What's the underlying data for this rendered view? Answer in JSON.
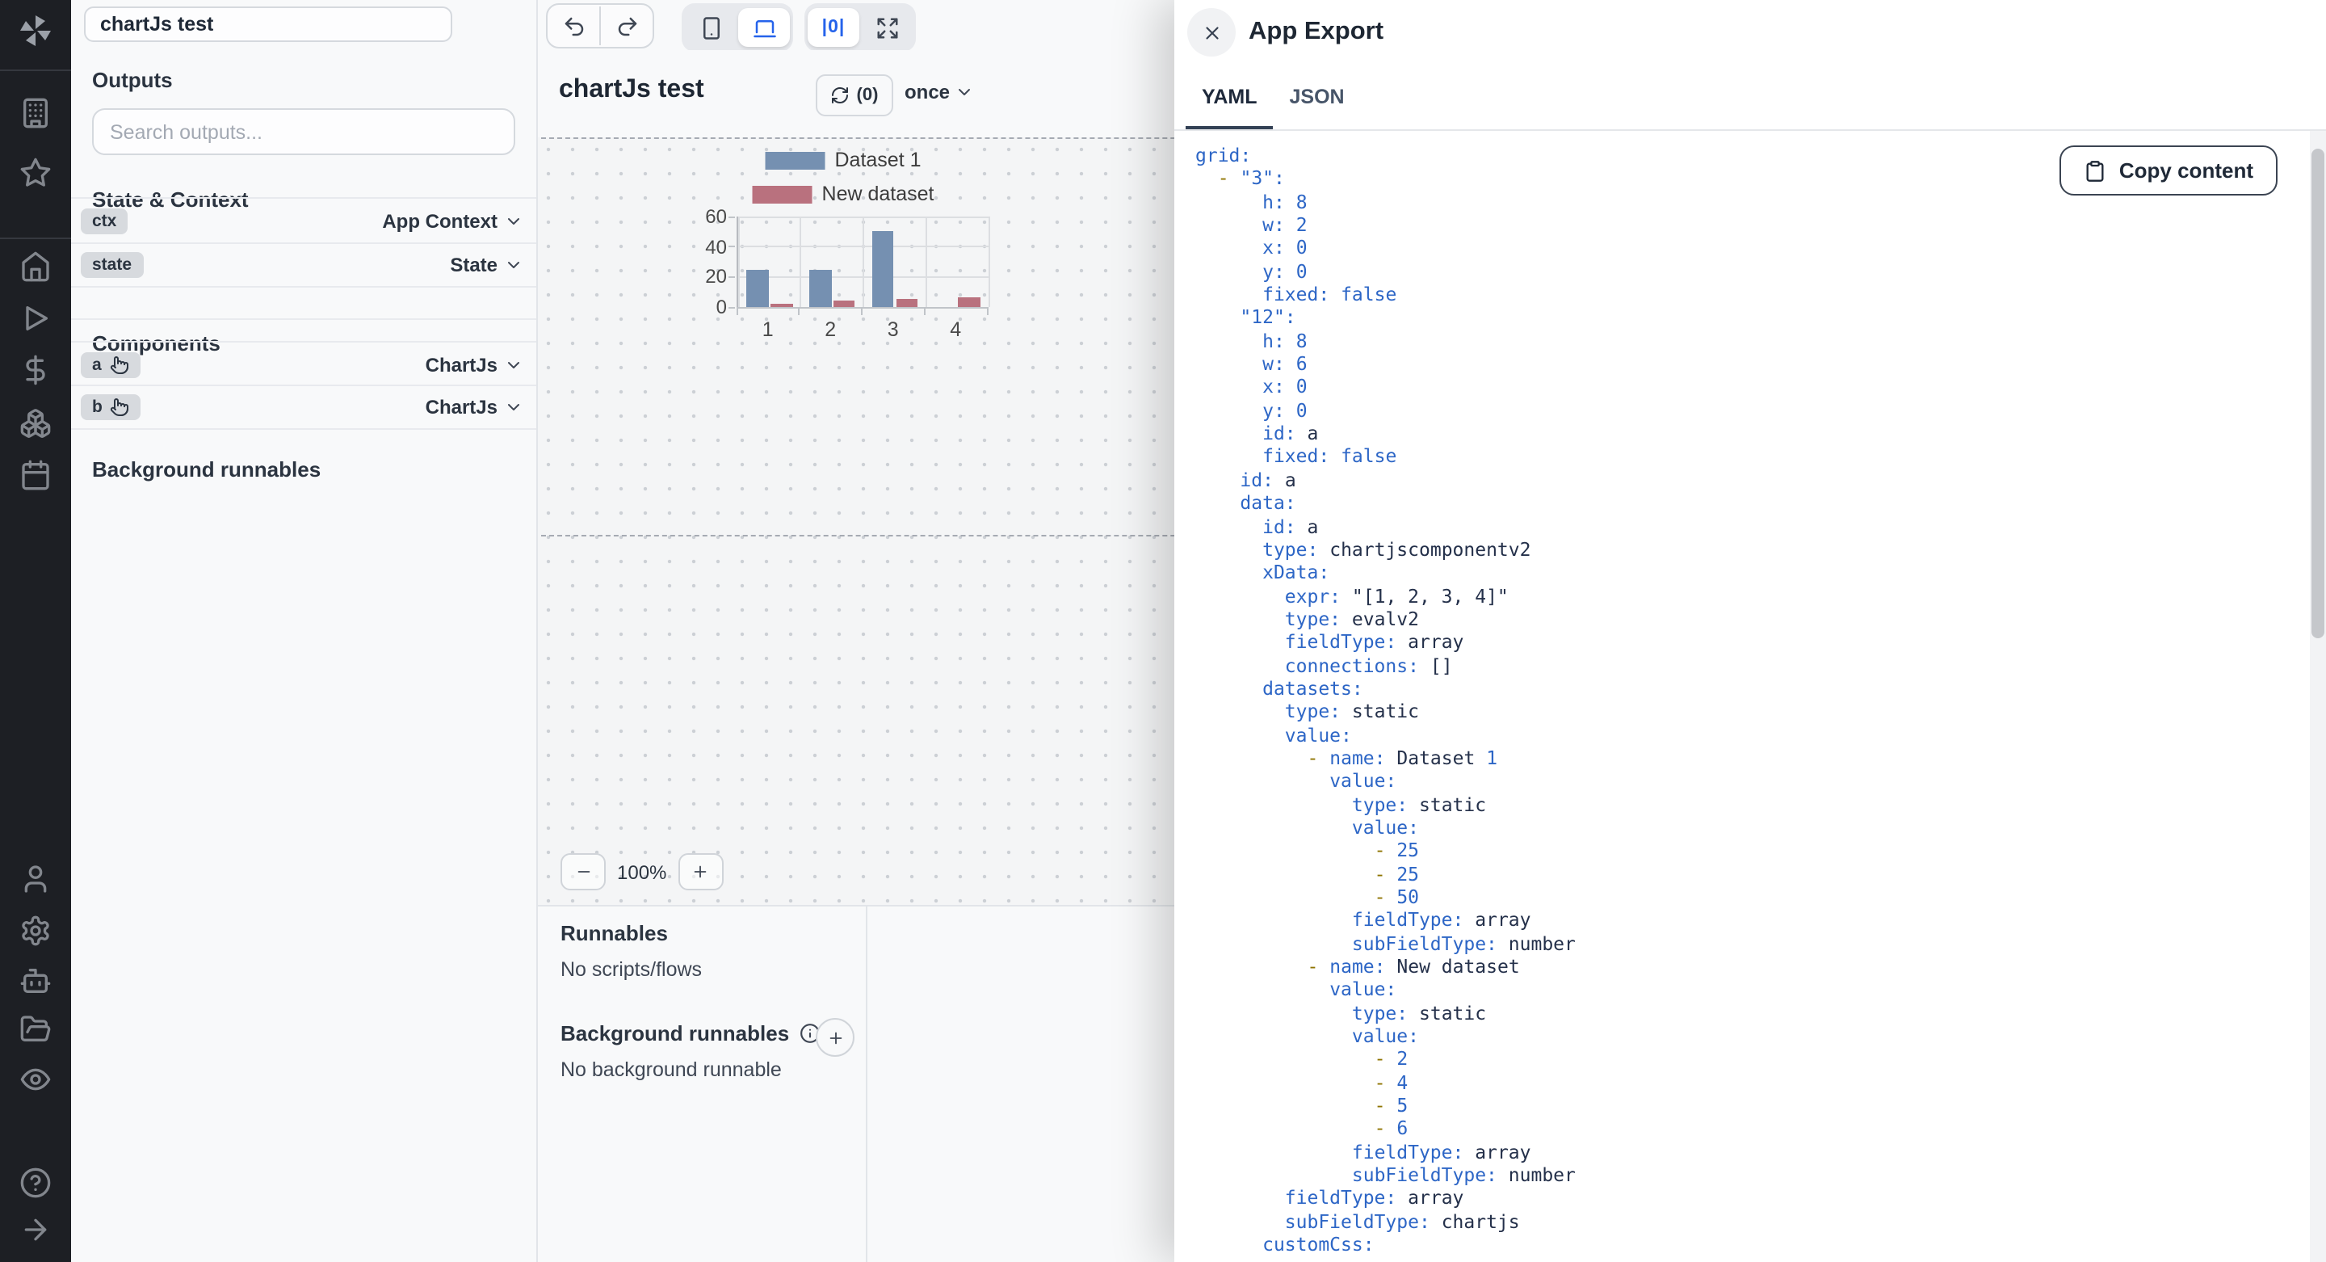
{
  "topbar": {
    "app_name_value": "chartJs test",
    "history_buttons": [
      {
        "icon": "undo"
      },
      {
        "icon": "redo"
      }
    ],
    "device_toggle": [
      {
        "icon": "smartphone",
        "active": false
      },
      {
        "icon": "laptop",
        "active": true
      }
    ],
    "view_toggle": {
      "zero_label": "|0|",
      "expand_icon": "expand"
    }
  },
  "sidebar": {
    "groups": [
      {
        "items": [
          "building",
          "star"
        ]
      },
      {
        "items": [
          "home",
          "play",
          "dollar-sign",
          "boxes",
          "calendar"
        ]
      },
      {
        "items": [
          "user",
          "settings",
          "bot",
          "folder-open",
          "eye"
        ]
      },
      {
        "items": [
          "help-circle",
          "arrow-right"
        ]
      }
    ]
  },
  "left_panel": {
    "outputs_title": "Outputs",
    "search_placeholder": "Search outputs...",
    "state_context_title": "State & Context",
    "state_rows": [
      {
        "id": "ctx",
        "type": "App Context"
      },
      {
        "id": "state",
        "type": "State"
      }
    ],
    "components_title": "Components",
    "component_rows": [
      {
        "id": "a",
        "type": "ChartJs"
      },
      {
        "id": "b",
        "type": "ChartJs"
      }
    ],
    "background_title": "Background runnables"
  },
  "editor": {
    "title": "chartJs test",
    "refresh_count": "(0)",
    "refresh_mode": "once",
    "zoom_level": "100%",
    "runnables_title": "Runnables",
    "runnables_empty": "No scripts/flows",
    "background_title": "Background runnables",
    "background_empty": "No background runnable"
  },
  "chart_data": {
    "type": "bar",
    "categories": [
      "1",
      "2",
      "3",
      "4"
    ],
    "series": [
      {
        "name": "Dataset 1",
        "color": "#7590b1",
        "values": [
          25,
          25,
          50
        ]
      },
      {
        "name": "New dataset",
        "color": "#b9717e",
        "values": [
          2,
          4,
          5,
          6
        ]
      }
    ],
    "title": "",
    "xlabel": "",
    "ylabel": "",
    "ylim": [
      0,
      60
    ],
    "yticks": [
      0,
      20,
      40,
      60
    ],
    "grid": true,
    "legend_position": "top"
  },
  "export_panel": {
    "title": "App Export",
    "tabs": [
      {
        "label": "YAML",
        "active": true
      },
      {
        "label": "JSON",
        "active": false
      }
    ],
    "copy_button": "Copy content",
    "yaml_lines": [
      {
        "i": 0,
        "t": [
          [
            "k",
            "grid:"
          ]
        ]
      },
      {
        "i": 2,
        "t": [
          [
            "d",
            "-"
          ],
          [
            "k",
            "\"3\":"
          ]
        ]
      },
      {
        "i": 6,
        "t": [
          [
            "k",
            "h:"
          ],
          [
            "n",
            "8"
          ]
        ]
      },
      {
        "i": 6,
        "t": [
          [
            "k",
            "w:"
          ],
          [
            "n",
            "2"
          ]
        ]
      },
      {
        "i": 6,
        "t": [
          [
            "k",
            "x:"
          ],
          [
            "n",
            "0"
          ]
        ]
      },
      {
        "i": 6,
        "t": [
          [
            "k",
            "y:"
          ],
          [
            "n",
            "0"
          ]
        ]
      },
      {
        "i": 6,
        "t": [
          [
            "k",
            "fixed:"
          ],
          [
            "n",
            "false"
          ]
        ]
      },
      {
        "i": 4,
        "t": [
          [
            "k",
            "\"12\":"
          ]
        ]
      },
      {
        "i": 6,
        "t": [
          [
            "k",
            "h:"
          ],
          [
            "n",
            "8"
          ]
        ]
      },
      {
        "i": 6,
        "t": [
          [
            "k",
            "w:"
          ],
          [
            "n",
            "6"
          ]
        ]
      },
      {
        "i": 6,
        "t": [
          [
            "k",
            "x:"
          ],
          [
            "n",
            "0"
          ]
        ]
      },
      {
        "i": 6,
        "t": [
          [
            "k",
            "y:"
          ],
          [
            "n",
            "0"
          ]
        ]
      },
      {
        "i": 6,
        "t": [
          [
            "k",
            "id:"
          ],
          [
            "s",
            "a"
          ]
        ]
      },
      {
        "i": 6,
        "t": [
          [
            "k",
            "fixed:"
          ],
          [
            "n",
            "false"
          ]
        ]
      },
      {
        "i": 4,
        "t": [
          [
            "k",
            "id:"
          ],
          [
            "s",
            "a"
          ]
        ]
      },
      {
        "i": 4,
        "t": [
          [
            "k",
            "data:"
          ]
        ]
      },
      {
        "i": 6,
        "t": [
          [
            "k",
            "id:"
          ],
          [
            "s",
            "a"
          ]
        ]
      },
      {
        "i": 6,
        "t": [
          [
            "k",
            "type:"
          ],
          [
            "s",
            "chartjscomponentv2"
          ]
        ]
      },
      {
        "i": 6,
        "t": [
          [
            "k",
            "xData:"
          ]
        ]
      },
      {
        "i": 8,
        "t": [
          [
            "k",
            "expr:"
          ],
          [
            "s",
            "\"[1, 2, 3, 4]\""
          ]
        ]
      },
      {
        "i": 8,
        "t": [
          [
            "k",
            "type:"
          ],
          [
            "s",
            "evalv2"
          ]
        ]
      },
      {
        "i": 8,
        "t": [
          [
            "k",
            "fieldType:"
          ],
          [
            "s",
            "array"
          ]
        ]
      },
      {
        "i": 8,
        "t": [
          [
            "k",
            "connections:"
          ],
          [
            "s",
            "[]"
          ]
        ]
      },
      {
        "i": 6,
        "t": [
          [
            "k",
            "datasets:"
          ]
        ]
      },
      {
        "i": 8,
        "t": [
          [
            "k",
            "type:"
          ],
          [
            "s",
            "static"
          ]
        ]
      },
      {
        "i": 8,
        "t": [
          [
            "k",
            "value:"
          ]
        ]
      },
      {
        "i": 10,
        "t": [
          [
            "d",
            "-"
          ],
          [
            "k",
            "name:"
          ],
          [
            "s",
            "Dataset"
          ],
          [
            "n",
            "1"
          ]
        ]
      },
      {
        "i": 12,
        "t": [
          [
            "k",
            "value:"
          ]
        ]
      },
      {
        "i": 14,
        "t": [
          [
            "k",
            "type:"
          ],
          [
            "s",
            "static"
          ]
        ]
      },
      {
        "i": 14,
        "t": [
          [
            "k",
            "value:"
          ]
        ]
      },
      {
        "i": 16,
        "t": [
          [
            "d",
            "-"
          ],
          [
            "n",
            "25"
          ]
        ]
      },
      {
        "i": 16,
        "t": [
          [
            "d",
            "-"
          ],
          [
            "n",
            "25"
          ]
        ]
      },
      {
        "i": 16,
        "t": [
          [
            "d",
            "-"
          ],
          [
            "n",
            "50"
          ]
        ]
      },
      {
        "i": 14,
        "t": [
          [
            "k",
            "fieldType:"
          ],
          [
            "s",
            "array"
          ]
        ]
      },
      {
        "i": 14,
        "t": [
          [
            "k",
            "subFieldType:"
          ],
          [
            "s",
            "number"
          ]
        ]
      },
      {
        "i": 10,
        "t": [
          [
            "d",
            "-"
          ],
          [
            "k",
            "name:"
          ],
          [
            "s",
            "New dataset"
          ]
        ]
      },
      {
        "i": 12,
        "t": [
          [
            "k",
            "value:"
          ]
        ]
      },
      {
        "i": 14,
        "t": [
          [
            "k",
            "type:"
          ],
          [
            "s",
            "static"
          ]
        ]
      },
      {
        "i": 14,
        "t": [
          [
            "k",
            "value:"
          ]
        ]
      },
      {
        "i": 16,
        "t": [
          [
            "d",
            "-"
          ],
          [
            "n",
            "2"
          ]
        ]
      },
      {
        "i": 16,
        "t": [
          [
            "d",
            "-"
          ],
          [
            "n",
            "4"
          ]
        ]
      },
      {
        "i": 16,
        "t": [
          [
            "d",
            "-"
          ],
          [
            "n",
            "5"
          ]
        ]
      },
      {
        "i": 16,
        "t": [
          [
            "d",
            "-"
          ],
          [
            "n",
            "6"
          ]
        ]
      },
      {
        "i": 14,
        "t": [
          [
            "k",
            "fieldType:"
          ],
          [
            "s",
            "array"
          ]
        ]
      },
      {
        "i": 14,
        "t": [
          [
            "k",
            "subFieldType:"
          ],
          [
            "s",
            "number"
          ]
        ]
      },
      {
        "i": 8,
        "t": [
          [
            "k",
            "fieldType:"
          ],
          [
            "s",
            "array"
          ]
        ]
      },
      {
        "i": 8,
        "t": [
          [
            "k",
            "subFieldType:"
          ],
          [
            "s",
            "chartjs"
          ]
        ]
      },
      {
        "i": 6,
        "t": [
          [
            "k",
            "customCss:"
          ]
        ]
      }
    ]
  }
}
